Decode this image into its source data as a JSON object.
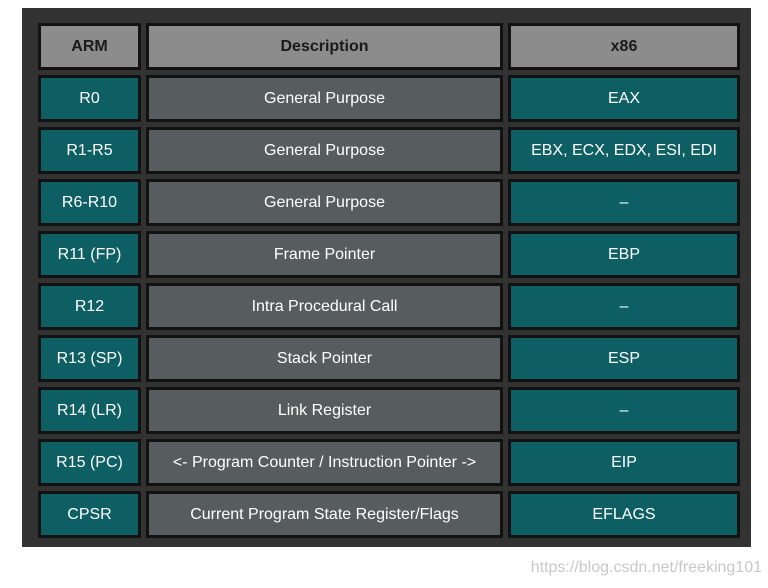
{
  "table": {
    "header": {
      "arm": "ARM",
      "description": "Description",
      "x86": "x86"
    },
    "rows": [
      {
        "arm": "R0",
        "description": "General Purpose",
        "x86": "EAX"
      },
      {
        "arm": "R1-R5",
        "description": "General Purpose",
        "x86": "EBX, ECX, EDX, ESI, EDI"
      },
      {
        "arm": "R6-R10",
        "description": "General Purpose",
        "x86": "–"
      },
      {
        "arm": "R11 (FP)",
        "description": "Frame Pointer",
        "x86": "EBP"
      },
      {
        "arm": "R12",
        "description": "Intra Procedural Call",
        "x86": "–"
      },
      {
        "arm": "R13 (SP)",
        "description": "Stack Pointer",
        "x86": "ESP"
      },
      {
        "arm": "R14 (LR)",
        "description": "Link Register",
        "x86": "–"
      },
      {
        "arm": "R15 (PC)",
        "description": "<- Program Counter / Instruction Pointer ->",
        "x86": "EIP"
      },
      {
        "arm": "CPSR",
        "description": "Current Program State Register/Flags",
        "x86": "EFLAGS"
      }
    ]
  },
  "watermark": "https://blog.csdn.net/freeking101",
  "colors": {
    "frame": "#323232",
    "header": "#8c8c8c",
    "teal": "#0e5f64",
    "gray": "#575c5e",
    "border": "#121212"
  }
}
